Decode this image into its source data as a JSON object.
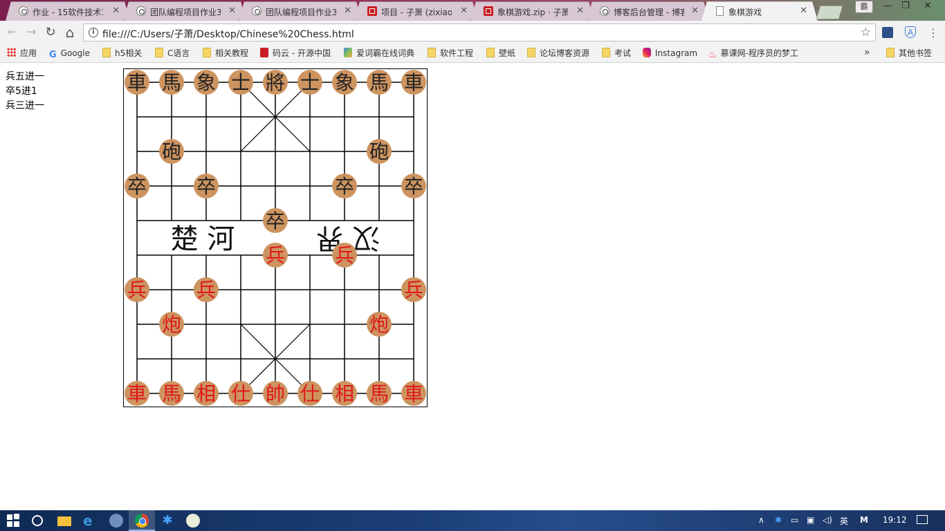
{
  "tabs": [
    {
      "title": "作业 - 15软件技术1",
      "icon": "cnblogs-icon",
      "active": false
    },
    {
      "title": "团队编程项目作业3",
      "icon": "cnblogs-icon",
      "active": false
    },
    {
      "title": "团队编程项目作业3",
      "icon": "cnblogs-icon",
      "active": false
    },
    {
      "title": "项目 - 子萧 (zixiao)",
      "icon": "gitee-icon",
      "active": false
    },
    {
      "title": "象棋游戏.zip · 子萧/",
      "icon": "gitee-icon",
      "active": false
    },
    {
      "title": "博客后台管理 - 博客",
      "icon": "cnblogs-icon",
      "active": false
    },
    {
      "title": "象棋游戏",
      "icon": "page-icon",
      "active": true
    }
  ],
  "window": {
    "user_glyph": "霸",
    "minimize": "—",
    "maximize": "❐",
    "close": "✕"
  },
  "toolbar": {
    "url": "file:///C:/Users/子萧/Desktop/Chinese%20Chess.html",
    "back": "←",
    "forward": "→",
    "reload": "↻",
    "home": "⌂",
    "star": "☆",
    "menu": "⋮",
    "info": "i"
  },
  "bookmarks": {
    "items": [
      {
        "label": "应用",
        "icon": "apps-icon"
      },
      {
        "label": "Google",
        "icon": "google-icon"
      },
      {
        "label": "h5相关",
        "icon": "folder-icon"
      },
      {
        "label": "C语言",
        "icon": "folder-icon"
      },
      {
        "label": "相关教程",
        "icon": "folder-icon"
      },
      {
        "label": "码云 - 开源中国",
        "icon": "gitee-icon"
      },
      {
        "label": "爱词霸在线词典",
        "icon": "iciba-icon"
      },
      {
        "label": "软件工程",
        "icon": "folder-icon"
      },
      {
        "label": "壁纸",
        "icon": "folder-icon"
      },
      {
        "label": "论坛博客资源",
        "icon": "folder-icon"
      },
      {
        "label": "考试",
        "icon": "folder-icon"
      },
      {
        "label": "Instagram",
        "icon": "instagram-icon"
      },
      {
        "label": "慕课网-程序员的梦工厂",
        "icon": "flame-icon"
      }
    ],
    "more": "»",
    "other": "其他书签"
  },
  "moves": [
    "兵五进一",
    "卒5进1",
    "兵三进一"
  ],
  "board": {
    "river_left": "楚 河",
    "river_right": "汉 界",
    "line_color": "#000000",
    "piece_fill": "#cd9460",
    "black_color": "#222222",
    "red_color": "#e01818",
    "pieces": [
      {
        "char": "車",
        "side": "black",
        "file": 0,
        "rank": 0
      },
      {
        "char": "馬",
        "side": "black",
        "file": 1,
        "rank": 0
      },
      {
        "char": "象",
        "side": "black",
        "file": 2,
        "rank": 0
      },
      {
        "char": "士",
        "side": "black",
        "file": 3,
        "rank": 0
      },
      {
        "char": "將",
        "side": "black",
        "file": 4,
        "rank": 0
      },
      {
        "char": "士",
        "side": "black",
        "file": 5,
        "rank": 0
      },
      {
        "char": "象",
        "side": "black",
        "file": 6,
        "rank": 0
      },
      {
        "char": "馬",
        "side": "black",
        "file": 7,
        "rank": 0
      },
      {
        "char": "車",
        "side": "black",
        "file": 8,
        "rank": 0
      },
      {
        "char": "砲",
        "side": "black",
        "file": 1,
        "rank": 2
      },
      {
        "char": "砲",
        "side": "black",
        "file": 7,
        "rank": 2
      },
      {
        "char": "卒",
        "side": "black",
        "file": 0,
        "rank": 3
      },
      {
        "char": "卒",
        "side": "black",
        "file": 2,
        "rank": 3
      },
      {
        "char": "卒",
        "side": "black",
        "file": 6,
        "rank": 3
      },
      {
        "char": "卒",
        "side": "black",
        "file": 8,
        "rank": 3
      },
      {
        "char": "卒",
        "side": "black",
        "file": 4,
        "rank": 4
      },
      {
        "char": "兵",
        "side": "red",
        "file": 4,
        "rank": 5
      },
      {
        "char": "兵",
        "side": "red",
        "file": 6,
        "rank": 5
      },
      {
        "char": "兵",
        "side": "red",
        "file": 0,
        "rank": 6
      },
      {
        "char": "兵",
        "side": "red",
        "file": 2,
        "rank": 6
      },
      {
        "char": "兵",
        "side": "red",
        "file": 8,
        "rank": 6
      },
      {
        "char": "炮",
        "side": "red",
        "file": 1,
        "rank": 7
      },
      {
        "char": "炮",
        "side": "red",
        "file": 7,
        "rank": 7
      },
      {
        "char": "車",
        "side": "red",
        "file": 0,
        "rank": 9
      },
      {
        "char": "馬",
        "side": "red",
        "file": 1,
        "rank": 9
      },
      {
        "char": "相",
        "side": "red",
        "file": 2,
        "rank": 9
      },
      {
        "char": "仕",
        "side": "red",
        "file": 3,
        "rank": 9
      },
      {
        "char": "帥",
        "side": "red",
        "file": 4,
        "rank": 9
      },
      {
        "char": "仕",
        "side": "red",
        "file": 5,
        "rank": 9
      },
      {
        "char": "相",
        "side": "red",
        "file": 6,
        "rank": 9
      },
      {
        "char": "馬",
        "side": "red",
        "file": 7,
        "rank": 9
      },
      {
        "char": "車",
        "side": "red",
        "file": 8,
        "rank": 9
      }
    ]
  },
  "taskbar": {
    "tray_text": "英",
    "ime": "M",
    "clock": "19:12",
    "up_arrow": "∧"
  }
}
